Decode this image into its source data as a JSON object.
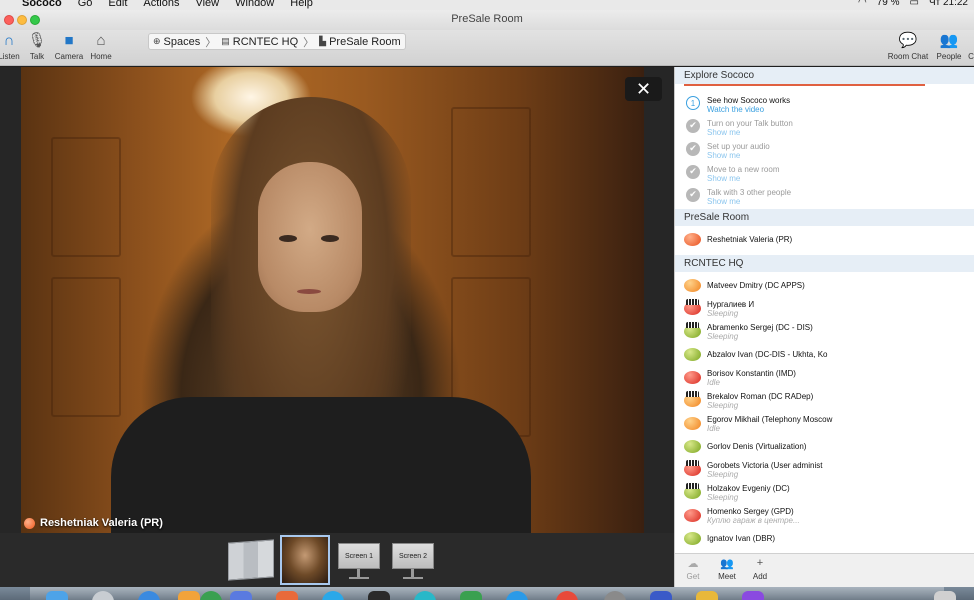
{
  "menubar": {
    "app": "Sococo",
    "menus": [
      "Go",
      "Edit",
      "Actions",
      "View",
      "Window",
      "Help"
    ],
    "battery": "79 %",
    "clock": "Чт 21:22"
  },
  "window": {
    "title": "PreSale Room"
  },
  "toolbar": {
    "listen": "Listen",
    "talk": "Talk",
    "camera": "Camera",
    "home": "Home",
    "room_chat": "Room Chat",
    "people": "People",
    "more": "C"
  },
  "breadcrumb": {
    "spaces": "Spaces",
    "hq": "RCNTEC HQ",
    "room": "PreSale Room"
  },
  "video": {
    "name_label": "Reshetniak Valeria (PR)"
  },
  "thumbnails": {
    "screen1": "Screen 1",
    "screen2": "Screen 2"
  },
  "sidebar": {
    "explore_title": "Explore Sococo",
    "steps": [
      {
        "num": "1",
        "title": "See how Sococo works",
        "link": "Watch the video"
      },
      {
        "title": "Turn on your Talk button",
        "link": "Show me"
      },
      {
        "title": "Set up your audio",
        "link": "Show me"
      },
      {
        "title": "Move to a new room",
        "link": "Show me"
      },
      {
        "title": "Talk with 3 other people",
        "link": "Show me"
      }
    ],
    "presale_title": "PreSale Room",
    "presale_people": [
      {
        "name": "Reshetniak Valeria (PR)"
      }
    ],
    "hq_title": "RCNTEC HQ",
    "hq_people": [
      {
        "name": "Matveev Dmitry (DC APPS)",
        "status": ""
      },
      {
        "name": "Нургалиев И",
        "status": "Sleeping"
      },
      {
        "name": "Abramenko Sergej (DC - DIS)",
        "status": "Sleeping"
      },
      {
        "name": "Abzalov Ivan (DC-DIS - Ukhta, Ko",
        "status": ""
      },
      {
        "name": "Borisov Konstantin (IMD)",
        "status": "Idle"
      },
      {
        "name": "Brekalov Roman (DC RADep)",
        "status": "Sleeping"
      },
      {
        "name": "Egorov Mikhail (Telephony Moscow",
        "status": "Idle"
      },
      {
        "name": "Gorlov Denis (Virtualization)",
        "status": ""
      },
      {
        "name": "Gorobets Victoria (User administ",
        "status": "Sleeping"
      },
      {
        "name": "Holzakov Evgeniy (DC)",
        "status": "Sleeping"
      },
      {
        "name": "Homenko Sergey (GPD)",
        "status": "Куплю гараж в центре..."
      },
      {
        "name": "Ignatov Ivan (DBR)",
        "status": ""
      }
    ],
    "bottom": {
      "get": "Get",
      "meet": "Meet",
      "add": "Add"
    }
  },
  "colors": {
    "accent": "#2277c7",
    "link": "#3aa0e0",
    "progress": "#e06040"
  }
}
